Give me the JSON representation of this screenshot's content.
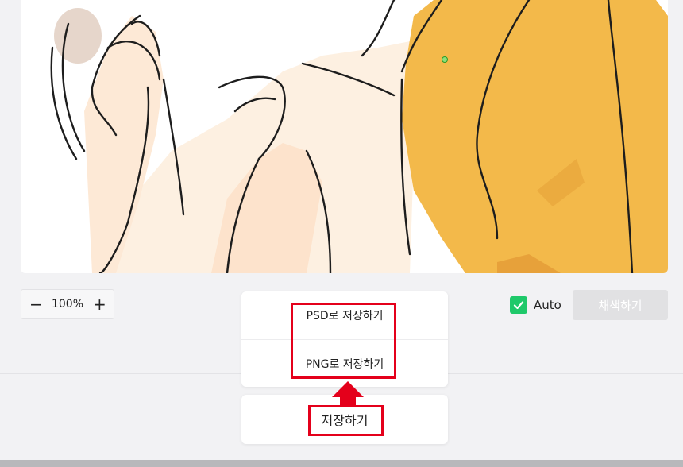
{
  "zoom": {
    "minus_label": "−",
    "value": "100%",
    "plus_label": "+"
  },
  "auto": {
    "label": "Auto",
    "checked": true
  },
  "colorize_button": {
    "label": "채색하기"
  },
  "save_menu": {
    "psd_label": "PSD로 저장하기",
    "png_label": "PNG로 저장하기"
  },
  "save_button": {
    "label": "저장하기"
  },
  "colors": {
    "accent_green": "#1fc96a",
    "highlight_red": "#e4001b",
    "shirt_yellow": "#f3b94a",
    "skin": "#fde3cc"
  },
  "image": {
    "subject": "line-art illustration with yellow colorized shirt and raised hand"
  }
}
